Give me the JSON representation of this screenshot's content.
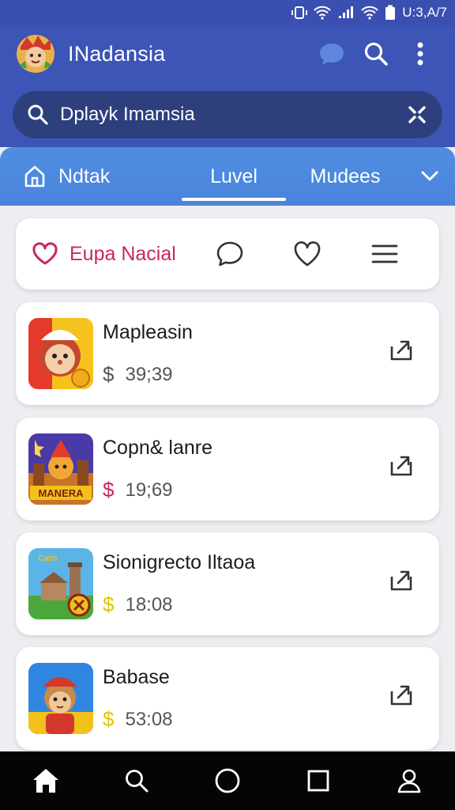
{
  "status_bar": {
    "time": "U:3,A/7"
  },
  "app_bar": {
    "title": "INadansia"
  },
  "search": {
    "value": "Dplayk Imamsia"
  },
  "tabs": [
    {
      "label": "Ndtak"
    },
    {
      "label": "Luvel"
    },
    {
      "label": "Mudees"
    }
  ],
  "filter": {
    "label": "Eupa Nacial"
  },
  "items": [
    {
      "title": "Mapleasin",
      "price": "39;39",
      "currency": "$",
      "currency_color": "#555555"
    },
    {
      "title": "Copn& lanre",
      "price": "19;69",
      "currency": "$",
      "currency_color": "#c8285c",
      "thumb_text": "MANERA"
    },
    {
      "title": "Sionigrecto Iltaoa",
      "price": "18:08",
      "currency": "$",
      "currency_color": "#e0c400",
      "thumb_text": "Catn"
    },
    {
      "title": "Babase",
      "price": "53:08",
      "currency": "$",
      "currency_color": "#e0c400"
    }
  ],
  "colors": {
    "app_bar": "#3c55b6",
    "tab_bar": "#4f8ee2",
    "accent_red": "#c8285c",
    "bottom_nav": "#050505"
  },
  "icons": [
    "wifi-icon",
    "signal-icon",
    "battery-icon",
    "chat-icon",
    "search-icon",
    "more-icon",
    "clear-icon",
    "home-icon",
    "chevron-down-icon",
    "heart-icon",
    "comment-icon",
    "favorite-icon",
    "menu-icon",
    "share-icon",
    "circle-icon",
    "square-icon",
    "profile-icon"
  ]
}
